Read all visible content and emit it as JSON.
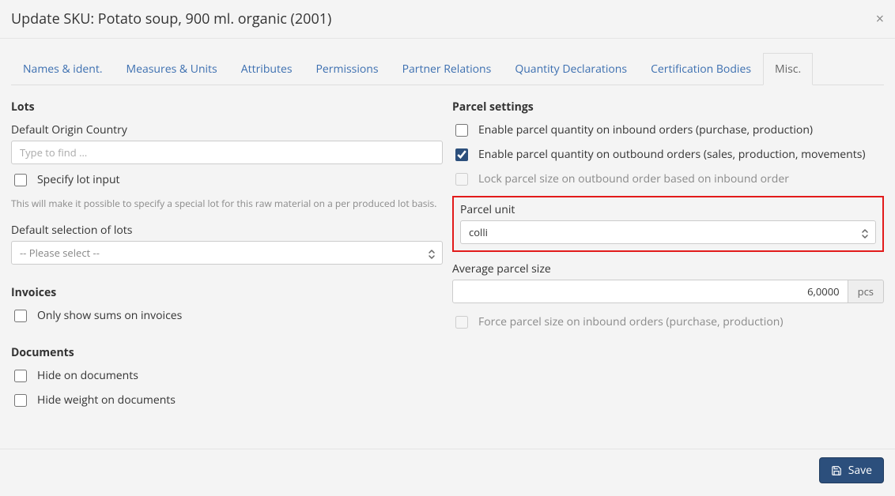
{
  "header": {
    "title": "Update SKU: Potato soup, 900 ml. organic (2001)",
    "close": "×"
  },
  "tabs": {
    "names": "Names & ident.",
    "measures": "Measures & Units",
    "attributes": "Attributes",
    "permissions": "Permissions",
    "partner": "Partner Relations",
    "quantity": "Quantity Declarations",
    "certification": "Certification Bodies",
    "misc": "Misc."
  },
  "lots": {
    "heading": "Lots",
    "default_origin_label": "Default Origin Country",
    "default_origin_placeholder": "Type to find …",
    "specify_lot_label": "Specify lot input",
    "specify_lot_help": "This will make it possible to specify a special lot for this raw material on a per produced lot basis.",
    "default_selection_label": "Default selection of lots",
    "default_selection_value": "-- Please select --"
  },
  "invoices": {
    "heading": "Invoices",
    "only_sums_label": "Only show sums on invoices"
  },
  "documents": {
    "heading": "Documents",
    "hide_on_docs_label": "Hide on documents",
    "hide_weight_label": "Hide weight on documents"
  },
  "parcel": {
    "heading": "Parcel settings",
    "enable_inbound_label": "Enable parcel quantity on inbound orders (purchase, production)",
    "enable_outbound_label": "Enable parcel quantity on outbound orders (sales, production, movements)",
    "lock_label": "Lock parcel size on outbound order based on inbound order",
    "unit_label": "Parcel unit",
    "unit_value": "colli",
    "avg_size_label": "Average parcel size",
    "avg_size_value": "6,0000",
    "avg_size_unit": "pcs",
    "force_label": "Force parcel size on inbound orders (purchase, production)"
  },
  "footer": {
    "save": "Save"
  }
}
